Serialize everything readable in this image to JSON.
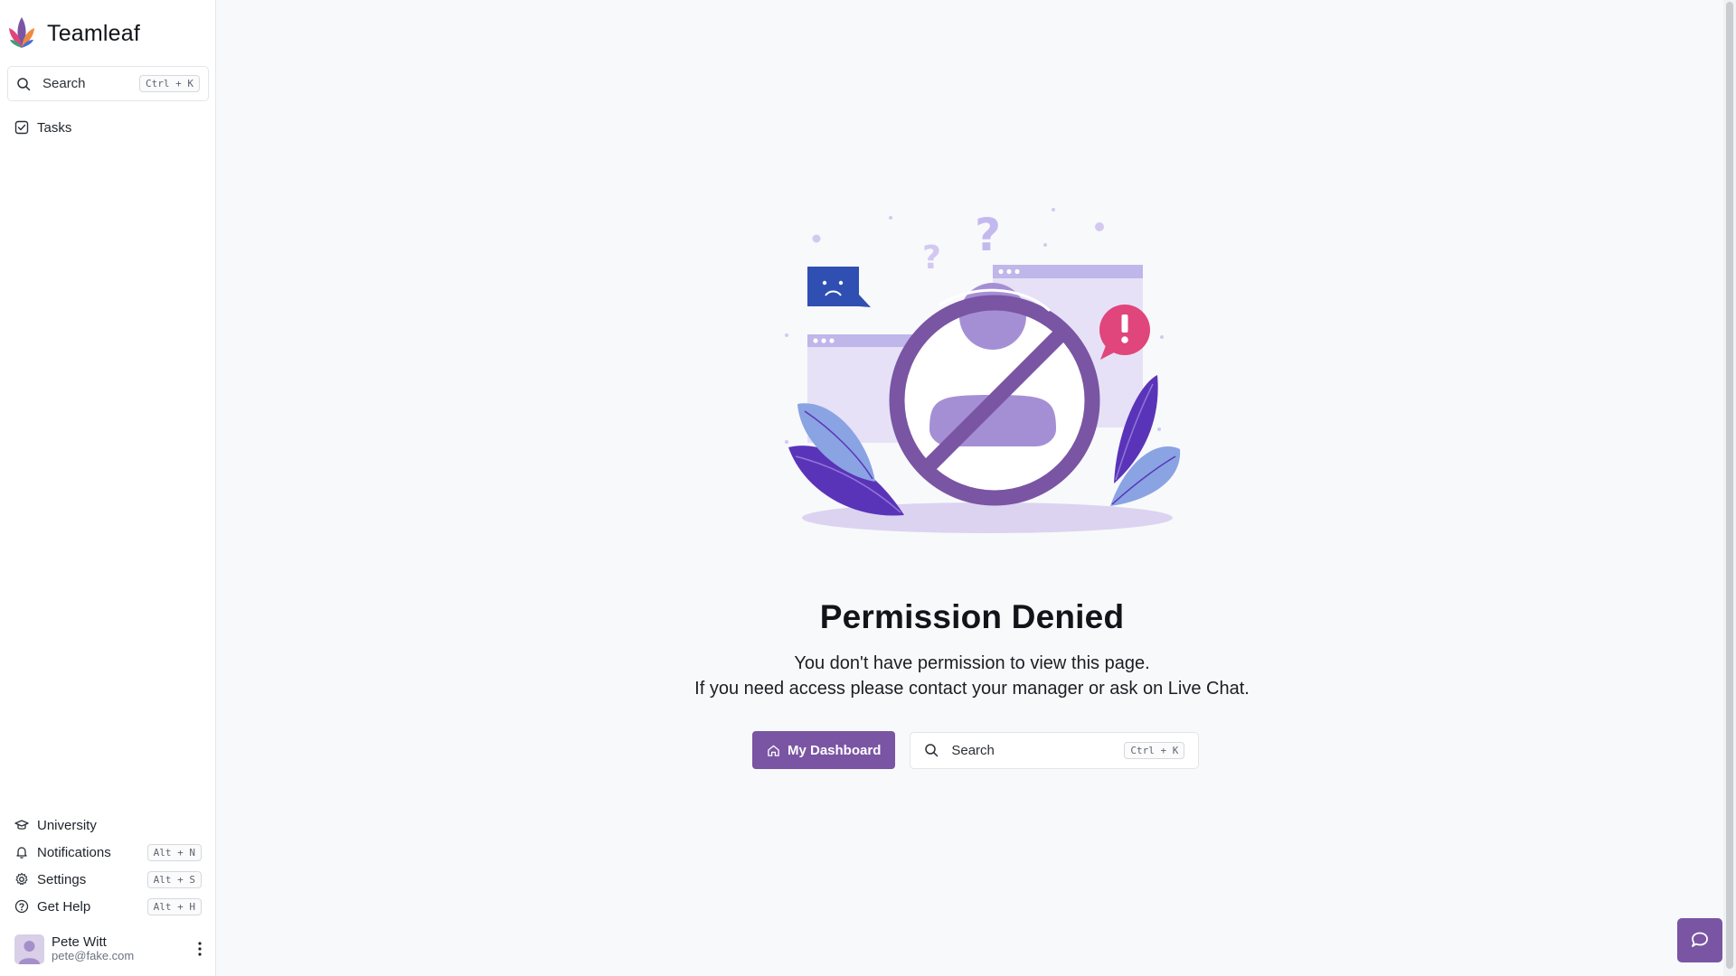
{
  "app": {
    "name": "Teamleaf"
  },
  "colors": {
    "accent": "#7a55a3",
    "alert": "#e0457b",
    "sidebar_bg": "#ffffff",
    "page_bg": "#f8f9fb"
  },
  "sidebar": {
    "search": {
      "label": "Search",
      "shortcut": "Ctrl + K",
      "icon": "search-icon"
    },
    "nav": [
      {
        "label": "Tasks",
        "icon": "task-checkbox-icon"
      }
    ],
    "bottom_nav": [
      {
        "label": "University",
        "icon": "graduation-cap-icon",
        "shortcut": ""
      },
      {
        "label": "Notifications",
        "icon": "bell-icon",
        "shortcut": "Alt + N"
      },
      {
        "label": "Settings",
        "icon": "gear-icon",
        "shortcut": "Alt + S"
      },
      {
        "label": "Get Help",
        "icon": "help-circle-icon",
        "shortcut": "Alt + H"
      }
    ],
    "user": {
      "name": "Pete Witt",
      "email": "pete@fake.com"
    }
  },
  "main": {
    "title": "Permission Denied",
    "message_line1": "You don't have permission to view this page.",
    "message_line2": "If you need access please contact your manager or ask on Live Chat.",
    "dashboard_button": {
      "label": "My Dashboard",
      "icon": "home-icon"
    },
    "search": {
      "label": "Search",
      "shortcut": "Ctrl + K",
      "icon": "search-icon"
    }
  },
  "chat": {
    "icon": "chat-bubble-icon"
  }
}
